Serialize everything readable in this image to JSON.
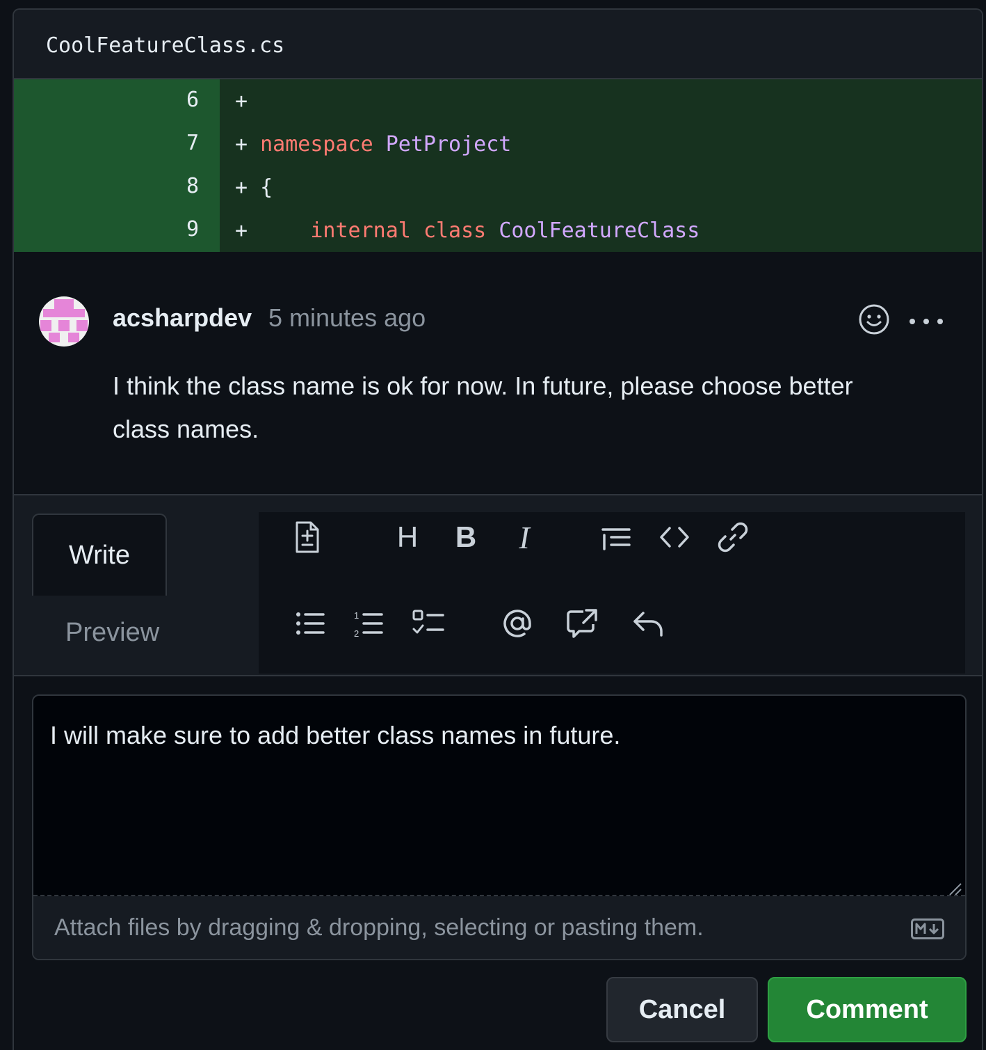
{
  "file": {
    "name": "CoolFeatureClass.cs"
  },
  "diff": {
    "lines": [
      {
        "number": "6",
        "marker": "+",
        "indent": "",
        "kw1": "",
        "sp1": "",
        "kw2": "",
        "sp2": "",
        "ident": "",
        "plain": ""
      },
      {
        "number": "7",
        "marker": "+",
        "indent": " ",
        "kw1": "namespace",
        "sp1": " ",
        "kw2": "",
        "sp2": "",
        "ident": "PetProject",
        "plain": ""
      },
      {
        "number": "8",
        "marker": "+",
        "indent": " ",
        "kw1": "",
        "sp1": "",
        "kw2": "",
        "sp2": "",
        "ident": "",
        "plain": "{"
      },
      {
        "number": "9",
        "marker": "+",
        "indent": "     ",
        "kw1": "internal",
        "sp1": " ",
        "kw2": "class",
        "sp2": " ",
        "ident": "CoolFeatureClass",
        "plain": ""
      }
    ]
  },
  "comment": {
    "author": "acsharpdev",
    "time": "5 minutes ago",
    "body": "I think the class name is ok for now. In future, please choose better class names.",
    "icons": {
      "reaction": "smiley-icon",
      "more": "kebab-horizontal-icon"
    }
  },
  "editor": {
    "tabs": {
      "write": "Write",
      "preview": "Preview"
    },
    "toolbar": {
      "heading": "H",
      "bold": "B",
      "italic": "I",
      "icons": [
        "file-add-icon",
        "heading-icon",
        "bold-icon",
        "italic-icon",
        "quote-icon",
        "code-icon",
        "link-icon",
        "unordered-list-icon",
        "ordered-list-icon",
        "tasklist-icon",
        "mention-icon",
        "cross-reference-icon",
        "reply-icon"
      ]
    },
    "value": "I will make sure to add better class names in future.",
    "attach_hint": "Attach files by dragging & dropping, selecting or pasting them."
  },
  "actions": {
    "cancel": "Cancel",
    "comment": "Comment"
  },
  "colors": {
    "background": "#0d1117",
    "added_gutter": "#1d572e",
    "added_code": "#17321f",
    "keyword": "#ff7b72",
    "identifier": "#d2a8ff",
    "primary_button": "#238636"
  }
}
